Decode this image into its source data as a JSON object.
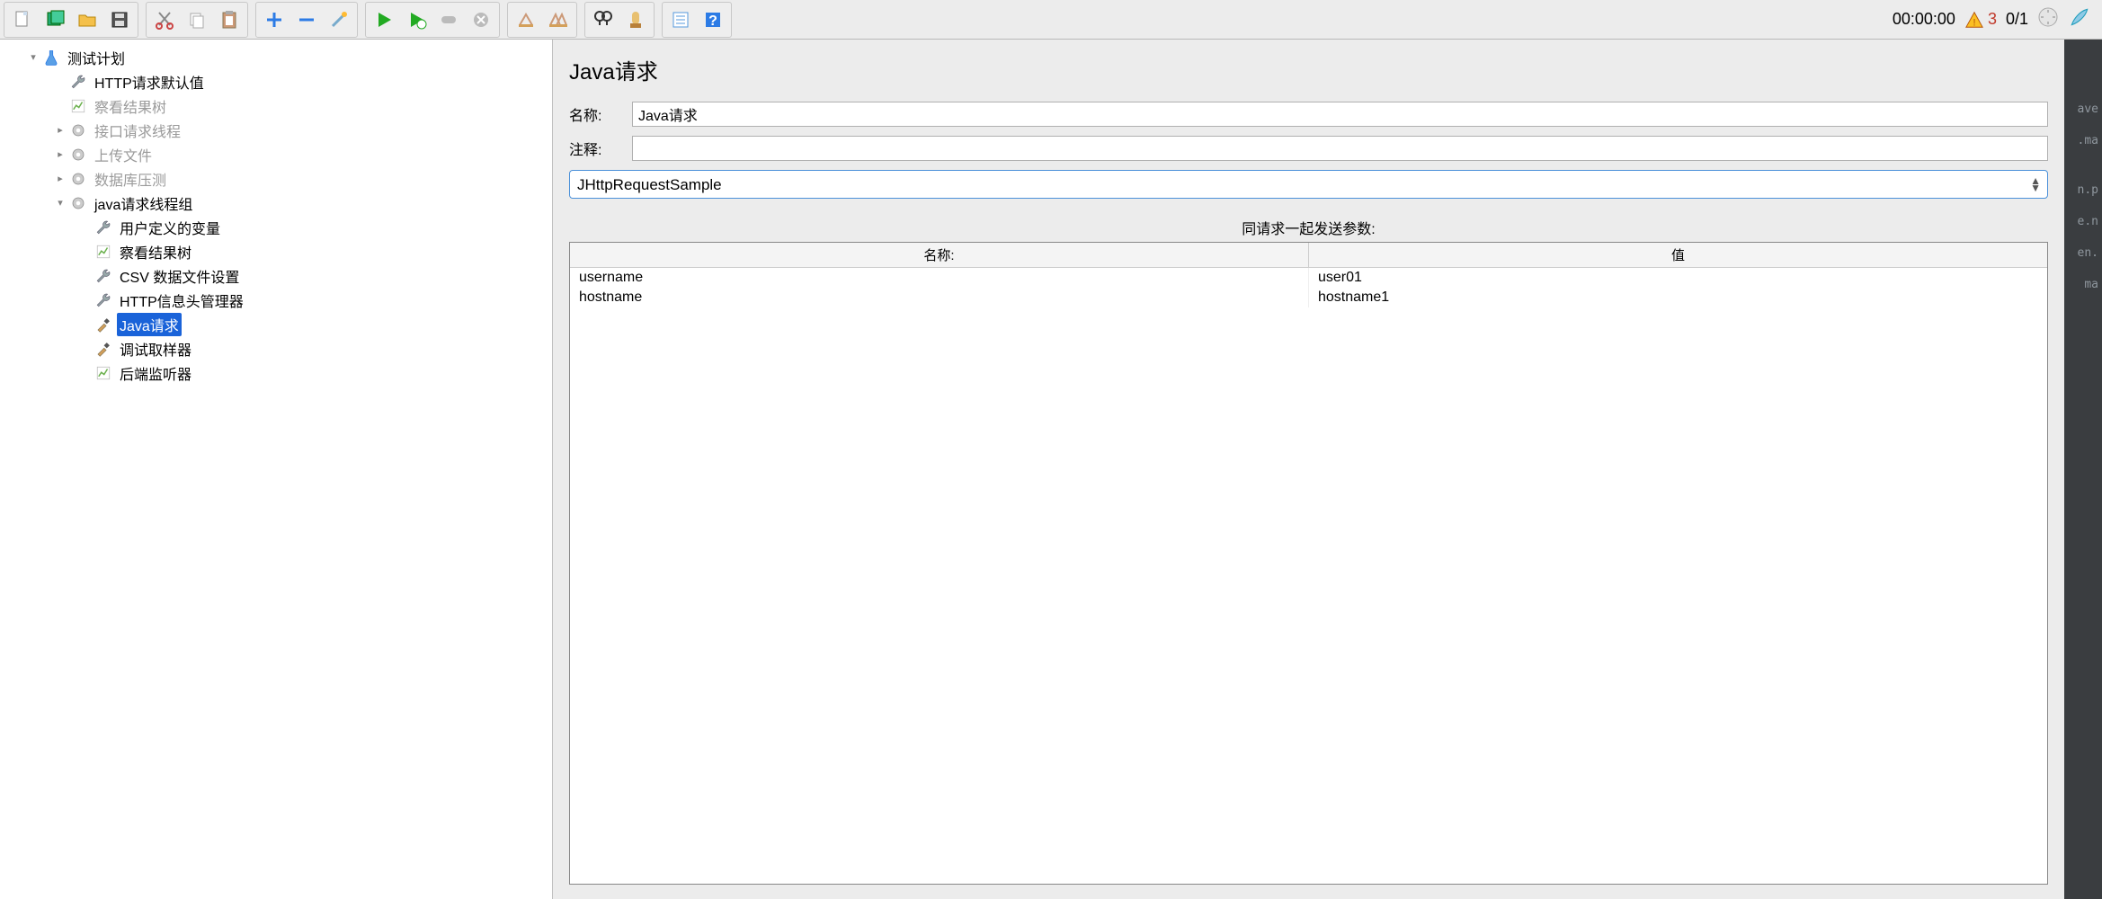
{
  "status": {
    "time": "00:00:00",
    "warn_count": "3",
    "threads": "0/1"
  },
  "tree": {
    "root": "测试计划",
    "root_children": [
      {
        "label": "HTTP请求默认值",
        "icon": "wrench"
      },
      {
        "label": "察看结果树",
        "icon": "chart",
        "disabled": true
      },
      {
        "label": "接口请求线程",
        "icon": "gear",
        "disabled": true,
        "arrow": true
      },
      {
        "label": "上传文件",
        "icon": "gear",
        "disabled": true,
        "arrow": true
      },
      {
        "label": "数据库压测",
        "icon": "gear",
        "disabled": true,
        "arrow": true
      },
      {
        "label": "java请求线程组",
        "icon": "gear",
        "expanded": true
      }
    ],
    "java_group_children": [
      {
        "label": "用户定义的变量",
        "icon": "wrench"
      },
      {
        "label": "察看结果树",
        "icon": "chart"
      },
      {
        "label": "CSV 数据文件设置",
        "icon": "wrench"
      },
      {
        "label": "HTTP信息头管理器",
        "icon": "wrench"
      },
      {
        "label": "Java请求",
        "icon": "dropper",
        "selected": true
      },
      {
        "label": "调试取样器",
        "icon": "dropper"
      },
      {
        "label": "后端监听器",
        "icon": "chart"
      }
    ]
  },
  "panel": {
    "title": "Java请求",
    "name_label": "名称:",
    "name_value": "Java请求",
    "comment_label": "注释:",
    "comment_value": "",
    "classname": "JHttpRequestSample",
    "params_title": "同请求一起发送参数:",
    "col_name": "名称:",
    "col_value": "值",
    "rows": [
      {
        "name": "username",
        "value": "user01"
      },
      {
        "name": "hostname",
        "value": "hostname1"
      }
    ]
  },
  "sidetext": [
    "ave",
    ".ma",
    "",
    "n.p",
    "e.n",
    "en.",
    "ma"
  ]
}
